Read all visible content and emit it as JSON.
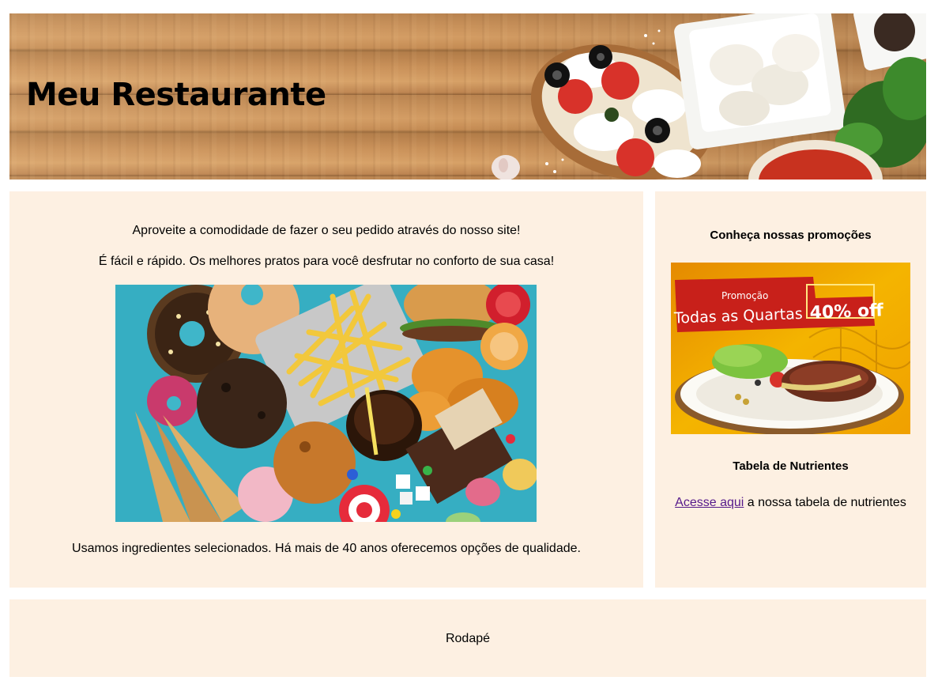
{
  "header": {
    "title": "Meu Restaurante"
  },
  "main": {
    "intro_line_1": "Aproveite a comodidade de fazer o seu pedido através do nosso site!",
    "intro_line_2": "É fácil e rápido. Os melhores pratos para você desfrutar no conforto de sua casa!",
    "bottom_line": "Usamos ingredientes selecionados. Há mais de 40 anos oferecemos opções de qualidade."
  },
  "sidebar": {
    "promo_heading": "Conheça nossas promoções",
    "promo_banner": {
      "small_label": "Promoção",
      "main_label": "Todas as Quartas",
      "discount": "40% off"
    },
    "nutrients_heading": "Tabela de Nutrientes",
    "nutrients_link_label": "Acesse aqui",
    "nutrients_text": " a nossa tabela de nutrientes"
  },
  "footer": {
    "label": "Rodapé"
  },
  "colors": {
    "panel_background": "#fdf0e2",
    "link": "#551a8b",
    "promo_red": "#c8201a",
    "promo_yellow": "#f4b400"
  }
}
